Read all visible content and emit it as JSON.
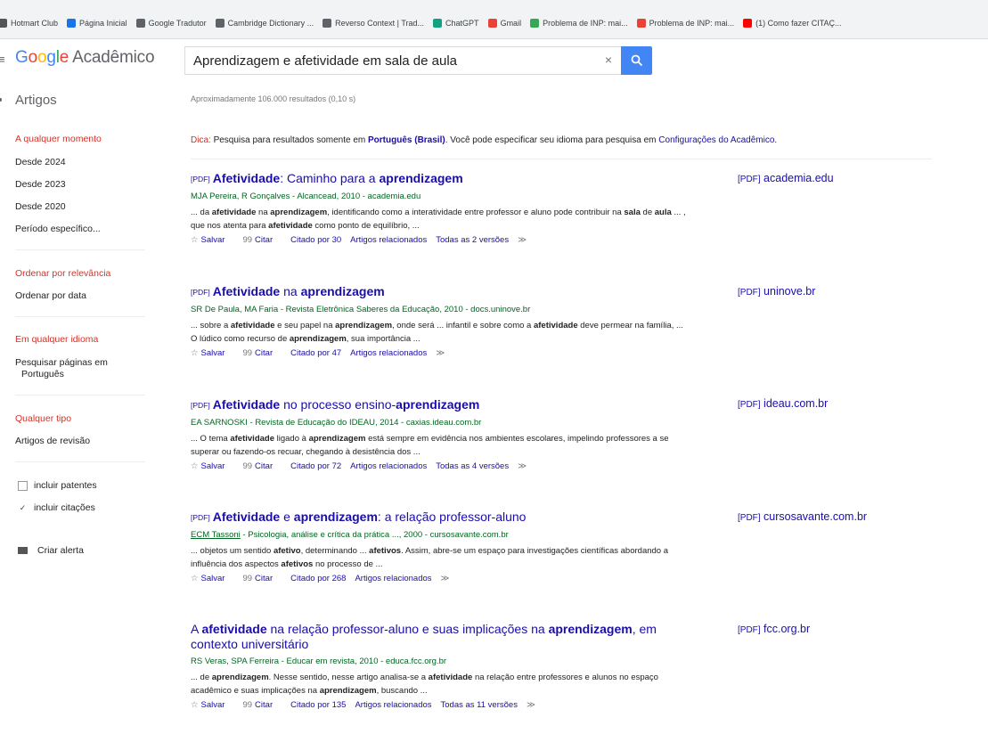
{
  "bookmarks": [
    {
      "label": "Hotmart Club",
      "color": "#555555"
    },
    {
      "label": "Página Inicial",
      "color": "#1a73e8"
    },
    {
      "label": "Google Tradutor",
      "color": "#5f6368"
    },
    {
      "label": "Cambridge Dictionary ...",
      "color": "#5f6368"
    },
    {
      "label": "Reverso Context | Trad...",
      "color": "#5f6368"
    },
    {
      "label": "ChatGPT",
      "color": "#10a37f"
    },
    {
      "label": "Gmail",
      "color": "#ea4335"
    },
    {
      "label": "Problema de INP: mai...",
      "color": "#34a853"
    },
    {
      "label": "Problema de INP: mai...",
      "color": "#ea4335"
    },
    {
      "label": "(1) Como fazer CITAÇ...",
      "color": "#ff0000"
    }
  ],
  "header": {
    "logo_g": "G",
    "logo_o1": "o",
    "logo_o2": "o",
    "logo_g2": "g",
    "logo_l": "l",
    "logo_e": "e",
    "logo_suffix": "Acadêmico",
    "search_value": "Aprendizagem e afetividade em sala de aula",
    "clear_icon": "×"
  },
  "sidebar": {
    "section": "Artigos",
    "time_header": "A qualquer momento",
    "time_items": [
      "Desde 2024",
      "Desde 2023",
      "Desde 2020",
      "Período específico..."
    ],
    "sort_header": "Ordenar por relevância",
    "sort_item": "Ordenar por data",
    "lang_header": "Em qualquer idioma",
    "lang_item_1": "Pesquisar páginas em",
    "lang_item_2": "Português",
    "type_header": "Qualquer tipo",
    "type_item": "Artigos de revisão",
    "check_patents": "incluir patentes",
    "check_citations": "incluir citações",
    "patents_checked": false,
    "citations_checked": true,
    "alert": "Criar alerta"
  },
  "stats": "Aproximadamente 106.000 resultados (0,10 s)",
  "tip": {
    "label": "Dica:",
    "text1": "Pesquisa para resultados somente em",
    "lang": "Português (Brasil)",
    "text2": ". Você pode especificar seu idioma para pesquisa em",
    "link": "Configurações do Acadêmico",
    "text3": "."
  },
  "results": [
    {
      "pdf_tag": "[PDF]",
      "title_parts": [
        [
          "Afetividade",
          true
        ],
        [
          ": Caminho para a ",
          false
        ],
        [
          "aprendizagem",
          true
        ]
      ],
      "meta": "MJA Pereira, R Gonçalves - Alcancead, 2010 - academia.edu",
      "snippet_parts": [
        [
          "... da ",
          false
        ],
        [
          "afetividade",
          true
        ],
        [
          " na ",
          false
        ],
        [
          "aprendizagem",
          true
        ],
        [
          ", identificando como a interatividade entre professor e aluno pode contribuir na ",
          false
        ],
        [
          "sala",
          true
        ],
        [
          " de ",
          false
        ],
        [
          "aula",
          true
        ],
        [
          " ... , que nos atenta para ",
          false
        ],
        [
          "afetividade",
          true
        ],
        [
          " como ponto de equilíbrio, ...",
          false
        ]
      ],
      "actions": {
        "save": "Salvar",
        "cite": "Citar",
        "cited": "Citado por 30",
        "related": "Artigos relacionados",
        "versions": "Todas as 2 versões"
      },
      "side": "academia.edu"
    },
    {
      "pdf_tag": "[PDF]",
      "title_parts": [
        [
          "Afetividade",
          true
        ],
        [
          " na ",
          false
        ],
        [
          "aprendizagem",
          true
        ]
      ],
      "meta": "SR De Paula, MA Faria - Revista Eletrônica Saberes da Educação, 2010 - docs.uninove.br",
      "snippet_parts": [
        [
          "... sobre a ",
          false
        ],
        [
          "afetividade",
          true
        ],
        [
          " e seu papel na ",
          false
        ],
        [
          "aprendizagem",
          true
        ],
        [
          ", onde será ... infantil e sobre como a ",
          false
        ],
        [
          "afetividade",
          true
        ],
        [
          " deve permear na família, ... O lúdico como recurso de ",
          false
        ],
        [
          "aprendizagem",
          true
        ],
        [
          ", sua importância ...",
          false
        ]
      ],
      "actions": {
        "save": "Salvar",
        "cite": "Citar",
        "cited": "Citado por 47",
        "related": "Artigos relacionados",
        "versions": ""
      },
      "side": "uninove.br"
    },
    {
      "pdf_tag": "[PDF]",
      "title_parts": [
        [
          "Afetividade",
          true
        ],
        [
          " no processo ensino-",
          false
        ],
        [
          "aprendizagem",
          true
        ]
      ],
      "meta": "EA SARNOSKI - Revista de Educação do IDEAU, 2014 - caxias.ideau.com.br",
      "snippet_parts": [
        [
          "... O tema ",
          false
        ],
        [
          "afetividade",
          true
        ],
        [
          " ligado à ",
          false
        ],
        [
          "aprendizagem",
          true
        ],
        [
          " está sempre em evidência nos ambientes escolares, impelindo professores a se superar ou fazendo-os recuar, chegando à desistência dos ...",
          false
        ]
      ],
      "actions": {
        "save": "Salvar",
        "cite": "Citar",
        "cited": "Citado por 72",
        "related": "Artigos relacionados",
        "versions": "Todas as 4 versões"
      },
      "side": "ideau.com.br"
    },
    {
      "pdf_tag": "[PDF]",
      "title_parts": [
        [
          "Afetividade",
          true
        ],
        [
          " e ",
          false
        ],
        [
          "aprendizagem",
          true
        ],
        [
          ": a relação professor-aluno",
          false
        ]
      ],
      "meta_author": "ECM Tassoni",
      "meta": " - Psicologia, análise e crítica da prática ..., 2000 - cursosavante.com.br",
      "snippet_parts": [
        [
          "... objetos um sentido ",
          false
        ],
        [
          "afetivo",
          true
        ],
        [
          ", determinando ... ",
          false
        ],
        [
          "afetivos",
          true
        ],
        [
          ". Assim, abre-se um espaço para investigações científicas abordando a influência dos aspectos ",
          false
        ],
        [
          "afetivos",
          true
        ],
        [
          " no processo de ...",
          false
        ]
      ],
      "actions": {
        "save": "Salvar",
        "cite": "Citar",
        "cited": "Citado por 268",
        "related": "Artigos relacionados",
        "versions": ""
      },
      "side": "cursosavante.com.br"
    },
    {
      "pdf_tag": "",
      "title_parts": [
        [
          "A ",
          false
        ],
        [
          "afetividade",
          true
        ],
        [
          " na relação professor-aluno e suas implicações na ",
          false
        ],
        [
          "aprendizagem",
          true
        ],
        [
          ", em contexto universitário",
          false
        ]
      ],
      "meta": "RS Veras, SPA Ferreira - Educar em revista, 2010 - educa.fcc.org.br",
      "snippet_parts": [
        [
          "... de ",
          false
        ],
        [
          "aprendizagem",
          true
        ],
        [
          ". Nesse sentido, nesse artigo analisa-se a ",
          false
        ],
        [
          "afetividade",
          true
        ],
        [
          " na relação entre professores e alunos no espaço acadêmico e suas implicações na ",
          false
        ],
        [
          "aprendizagem",
          true
        ],
        [
          ", buscando ...",
          false
        ]
      ],
      "actions": {
        "save": "Salvar",
        "cite": "Citar",
        "cited": "Citado por 135",
        "related": "Artigos relacionados",
        "versions": "Todas as 11 versões"
      },
      "side": "fcc.org.br"
    }
  ],
  "side_pdf_tag": "[PDF]",
  "icons": {
    "save": "☆",
    "cite": "99",
    "more": "≫"
  }
}
